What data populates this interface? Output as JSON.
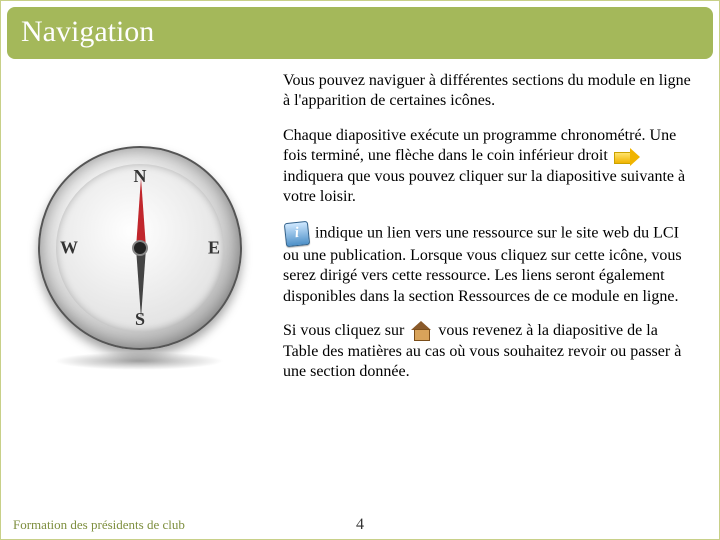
{
  "title": "Navigation",
  "intro": "Vous pouvez naviguer à différentes sections du module en ligne à l'apparition de certaines icônes.",
  "para2_a": "Chaque diapositive exécute un programme chronométré. Une fois terminé, une flèche dans le coin inférieur droit ",
  "para2_b": " indiquera que vous pouvez cliquer sur la diapositive suivante à votre loisir.",
  "para3_b": " indique un lien vers une ressource sur le site web du LCI ou une publication. Lorsque vous cliquez sur cette icône, vous serez dirigé vers cette ressource.  Les liens seront également disponibles dans la section Ressources de ce module en ligne.",
  "para4_a": "Si vous cliquez sur ",
  "para4_b": " vous revenez à la diapositive de la Table des matières au cas où vous souhaitez revoir ou passer à une section donnée.",
  "compass": {
    "n": "N",
    "s": "S",
    "e": "E",
    "w": "W"
  },
  "info_glyph": "i",
  "footer_text": "Formation des présidents de club",
  "page_number": "4"
}
